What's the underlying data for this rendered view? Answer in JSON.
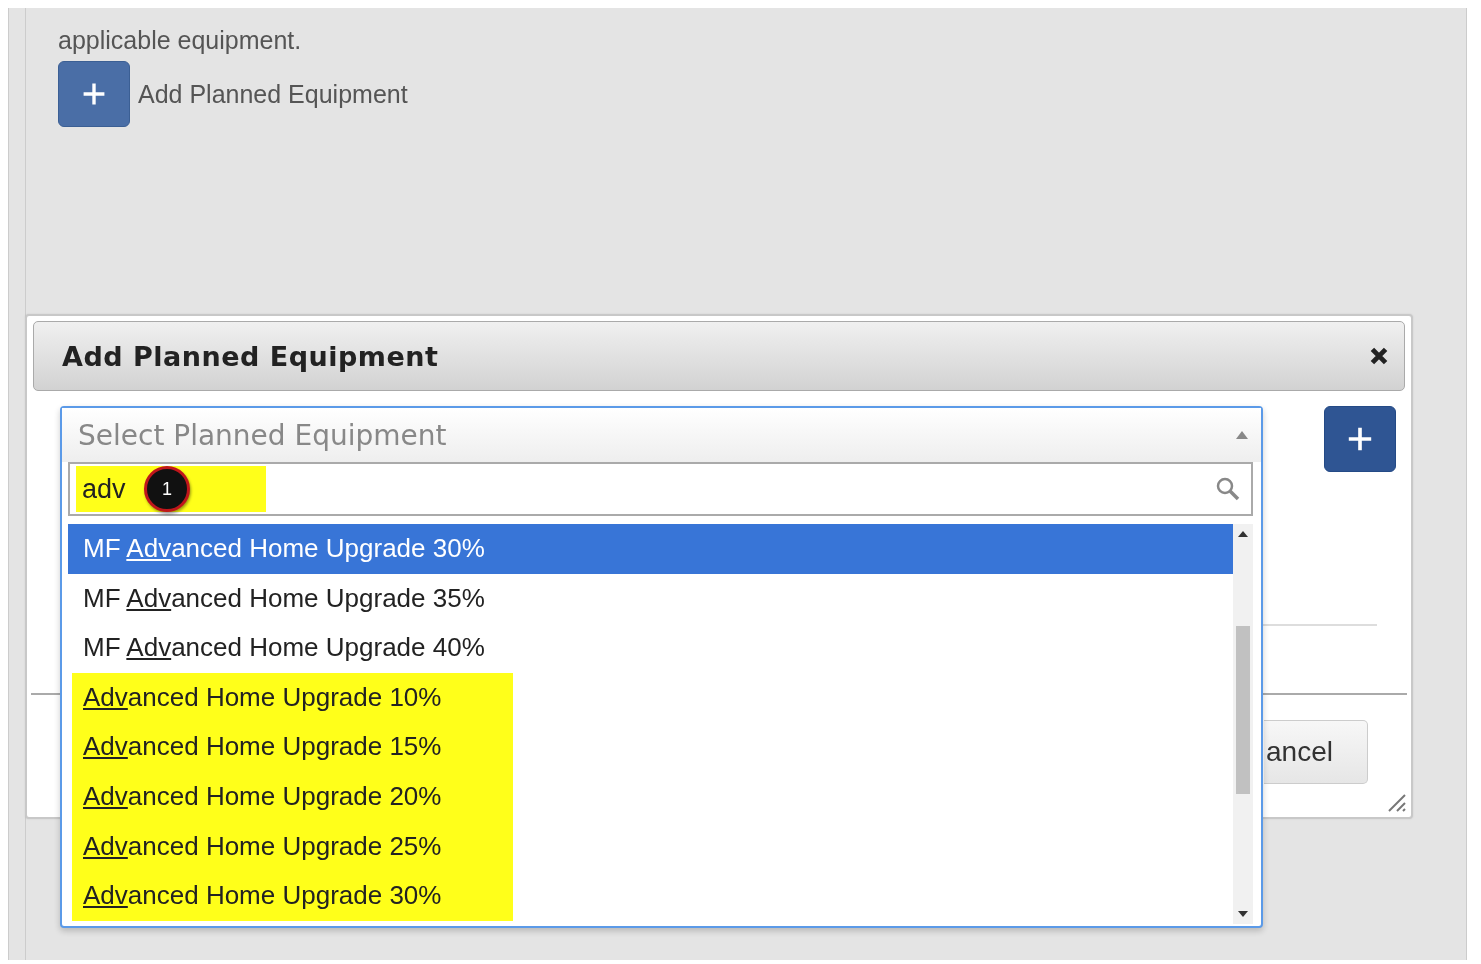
{
  "page": {
    "intro_text": "applicable equipment.",
    "add_button_label": "Add Planned Equipment"
  },
  "dialog": {
    "title": "Add Planned Equipment",
    "cancel_label": "ancel"
  },
  "select": {
    "placeholder": "Select Planned Equipment",
    "expanded": true,
    "search": {
      "value": "adv",
      "highlighted": true,
      "step_marker": "1"
    },
    "options": [
      {
        "prefix": "MF ",
        "match": "Adv",
        "rest": "anced Home Upgrade 30%",
        "selected": true,
        "highlighted": false
      },
      {
        "prefix": "MF ",
        "match": "Adv",
        "rest": "anced Home Upgrade 35%",
        "selected": false,
        "highlighted": false
      },
      {
        "prefix": "MF ",
        "match": "Adv",
        "rest": "anced Home Upgrade 40%",
        "selected": false,
        "highlighted": false
      },
      {
        "match": "Adv",
        "rest": "anced Home Upgrade 10%",
        "selected": false,
        "highlighted": true
      },
      {
        "match": "Adv",
        "rest": "anced Home Upgrade 15%",
        "selected": false,
        "highlighted": true
      },
      {
        "match": "Adv",
        "rest": "anced Home Upgrade 20%",
        "selected": false,
        "highlighted": true
      },
      {
        "match": "Adv",
        "rest": "anced Home Upgrade 25%",
        "selected": false,
        "highlighted": true
      },
      {
        "match": "Adv",
        "rest": "anced Home Upgrade 30%",
        "selected": false,
        "highlighted": true
      }
    ]
  }
}
